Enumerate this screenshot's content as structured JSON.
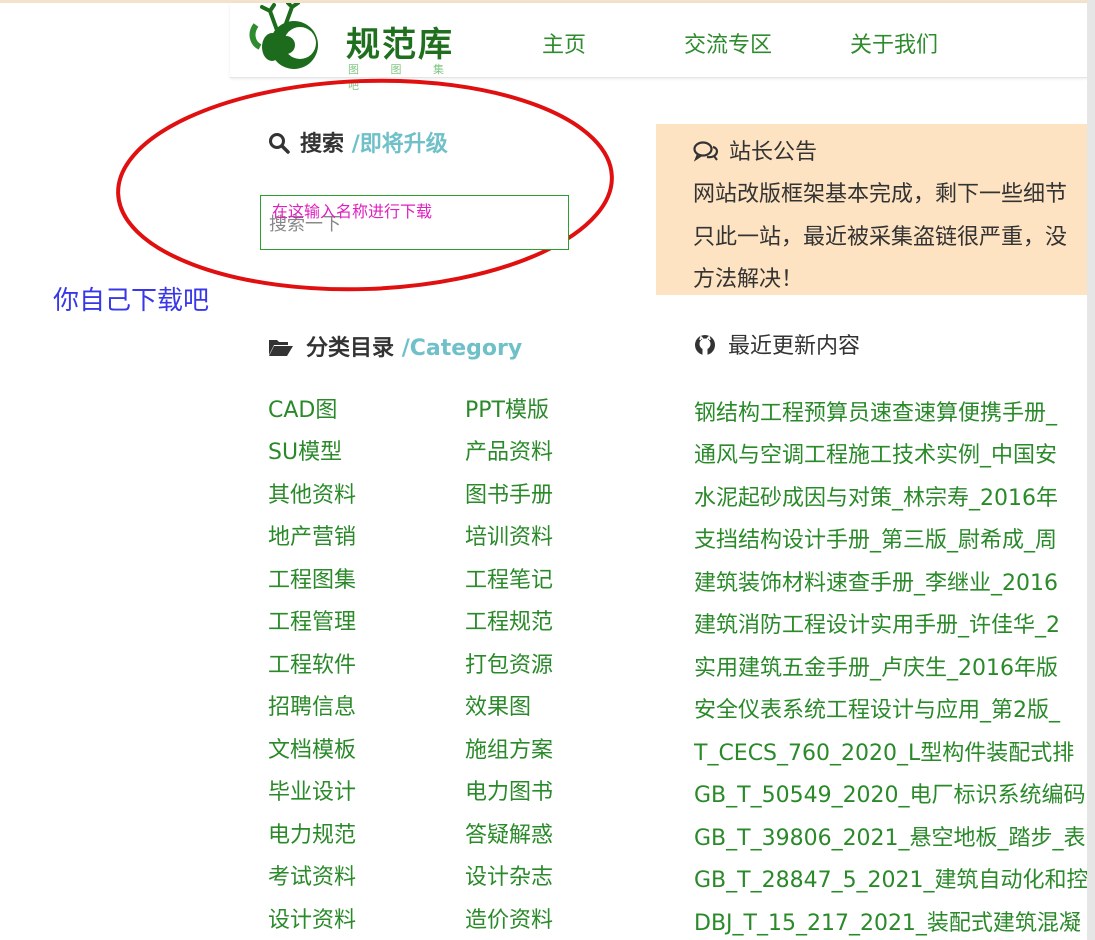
{
  "colors": {
    "accent_green": "#2a8a2a",
    "notice_bg": "#fde3c1",
    "subtitle_teal": "#6fc0c8",
    "annotation_red": "#e01010",
    "annotation_pink": "#e020c0",
    "annotation_blue": "#3838e8"
  },
  "header": {
    "logo_text": "规范库",
    "logo_sub": "图 图 集 吧",
    "nav": [
      "主页",
      "交流专区",
      "关于我们"
    ]
  },
  "search": {
    "title": "搜索",
    "subtitle": "/即将升级",
    "icon": "search-icon",
    "placeholder": "搜索一下"
  },
  "annotations": {
    "pink_note": "在这输入名称进行下载",
    "blue_note": "你自己下载吧"
  },
  "categories": {
    "title": "分类目录",
    "subtitle": "/Category",
    "icon": "folder-open-icon",
    "left": [
      "CAD图",
      "SU模型",
      "其他资料",
      "地产营销",
      "工程图集",
      "工程管理",
      "工程软件",
      "招聘信息",
      "文档模板",
      "毕业设计",
      "电力规范",
      "考试资料",
      "设计资料"
    ],
    "right": [
      "PPT模版",
      "产品资料",
      "图书手册",
      "培训资料",
      "工程笔记",
      "工程规范",
      "打包资源",
      "效果图",
      "施组方案",
      "电力图书",
      "答疑解惑",
      "设计杂志",
      "造价资料"
    ]
  },
  "notice": {
    "icon": "comments-icon",
    "title": "站长公告",
    "lines": [
      "网站改版框架基本完成，剩下一些细节",
      "只此一站，最近被采集盗链很严重，没",
      "方法解决！"
    ]
  },
  "updates": {
    "icon": "github-icon",
    "title": "最近更新内容",
    "items": [
      "钢结构工程预算员速查速算便携手册_",
      "通风与空调工程施工技术实例_中国安",
      "水泥起砂成因与对策_林宗寿_2016年",
      "支挡结构设计手册_第三版_尉希成_周",
      "建筑装饰材料速查手册_李继业_2016",
      "建筑消防工程设计实用手册_许佳华_2",
      "实用建筑五金手册_卢庆生_2016年版",
      "安全仪表系统工程设计与应用_第2版_",
      "T_CECS_760_2020_L型构件装配式排",
      "GB_T_50549_2020_电厂标识系统编码",
      "GB_T_39806_2021_悬空地板_踏步_表",
      "GB_T_28847_5_2021_建筑自动化和控",
      "DBJ_T_15_217_2021_装配式建筑混凝"
    ]
  }
}
